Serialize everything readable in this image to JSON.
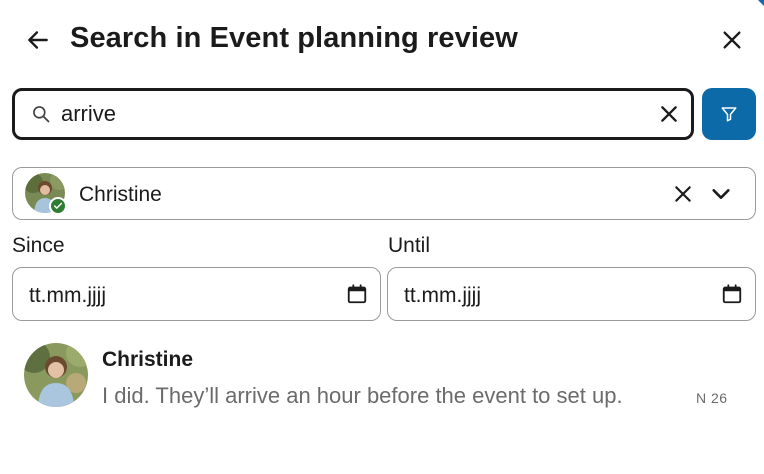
{
  "header": {
    "title": "Search in Event planning review",
    "back_icon": "arrow-left-icon",
    "close_icon": "close-icon"
  },
  "search": {
    "value": "arrive",
    "placeholder": "",
    "search_icon": "search-icon",
    "clear_icon": "close-icon",
    "filter_icon": "filter-icon"
  },
  "user_filter": {
    "selected_name": "Christine",
    "verified_badge_icon": "check-icon",
    "clear_icon": "close-icon",
    "dropdown_icon": "chevron-down-icon"
  },
  "dates": {
    "since_label": "Since",
    "since_value": "tt.mm.jjjj",
    "until_label": "Until",
    "until_value": "tt.mm.jjjj",
    "calendar_icon": "calendar-icon"
  },
  "results": [
    {
      "author": "Christine",
      "text": "I did. They’ll arrive an hour before the event to set up.",
      "date": "N 26"
    }
  ],
  "colors": {
    "accent": "#0d6aa8",
    "text_primary": "#1b1b1b",
    "text_secondary": "#6b6b6b",
    "border": "#9a9a9a",
    "verified": "#2e7d32"
  }
}
